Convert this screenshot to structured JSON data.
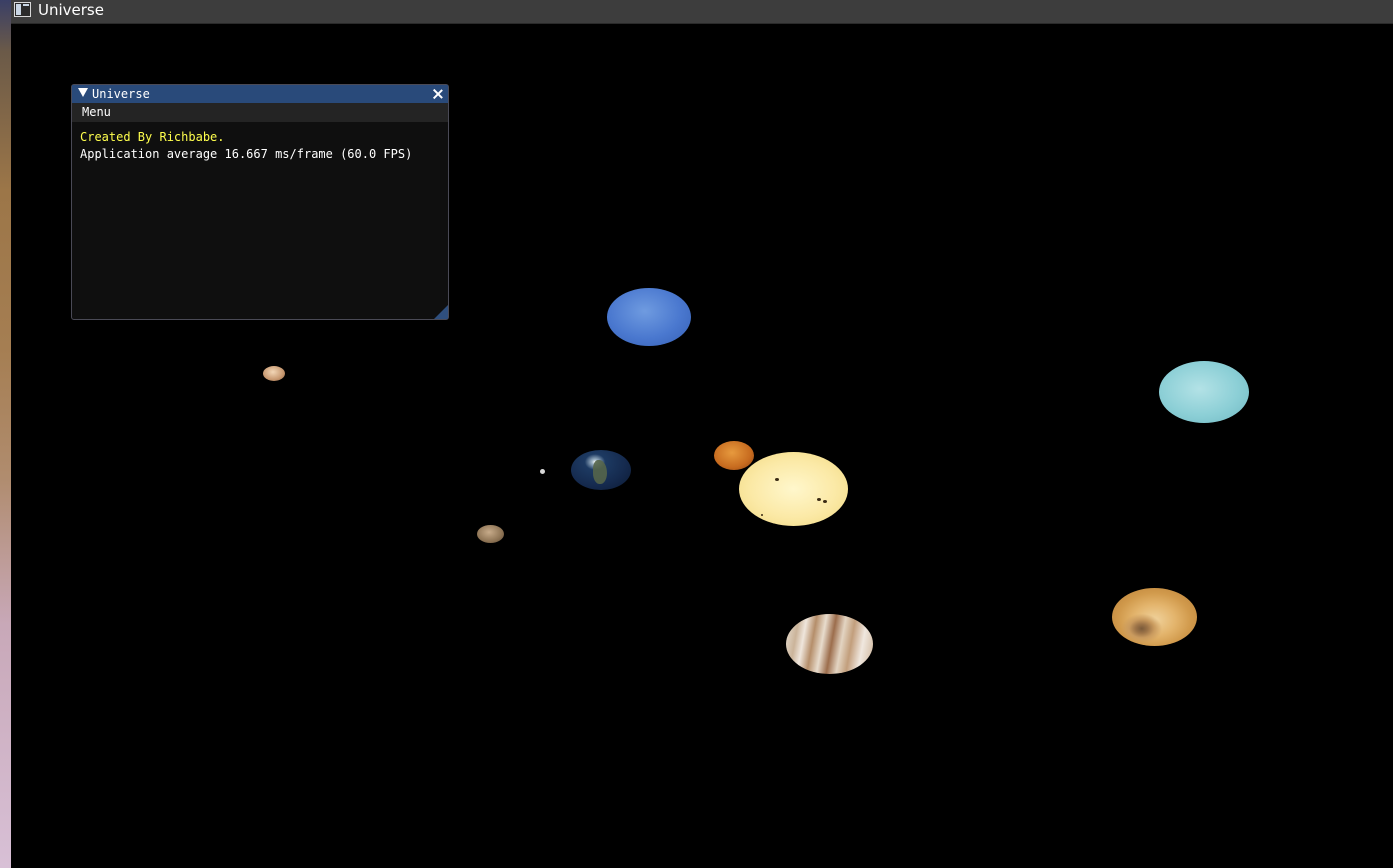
{
  "window": {
    "title": "Universe",
    "icon": "app-window-icon"
  },
  "imgui": {
    "title": "Universe",
    "collapse_icon": "triangle-down-icon",
    "close_icon": "close-icon",
    "menu": {
      "items": [
        "Menu"
      ]
    },
    "lines": {
      "credit": "Created By Richbabe.",
      "fps": "Application average 16.667 ms/frame (60.0 FPS)"
    },
    "colors": {
      "title_bg": "#294a7a",
      "credit_text": "#ffff4d",
      "window_bg": "#0f0f0f"
    }
  },
  "scene": {
    "background": "#000000",
    "bodies": [
      "sun",
      "mercury",
      "venus",
      "earth",
      "moon",
      "mars",
      "jupiter",
      "saturn",
      "uranus",
      "neptune",
      "pluto"
    ]
  }
}
